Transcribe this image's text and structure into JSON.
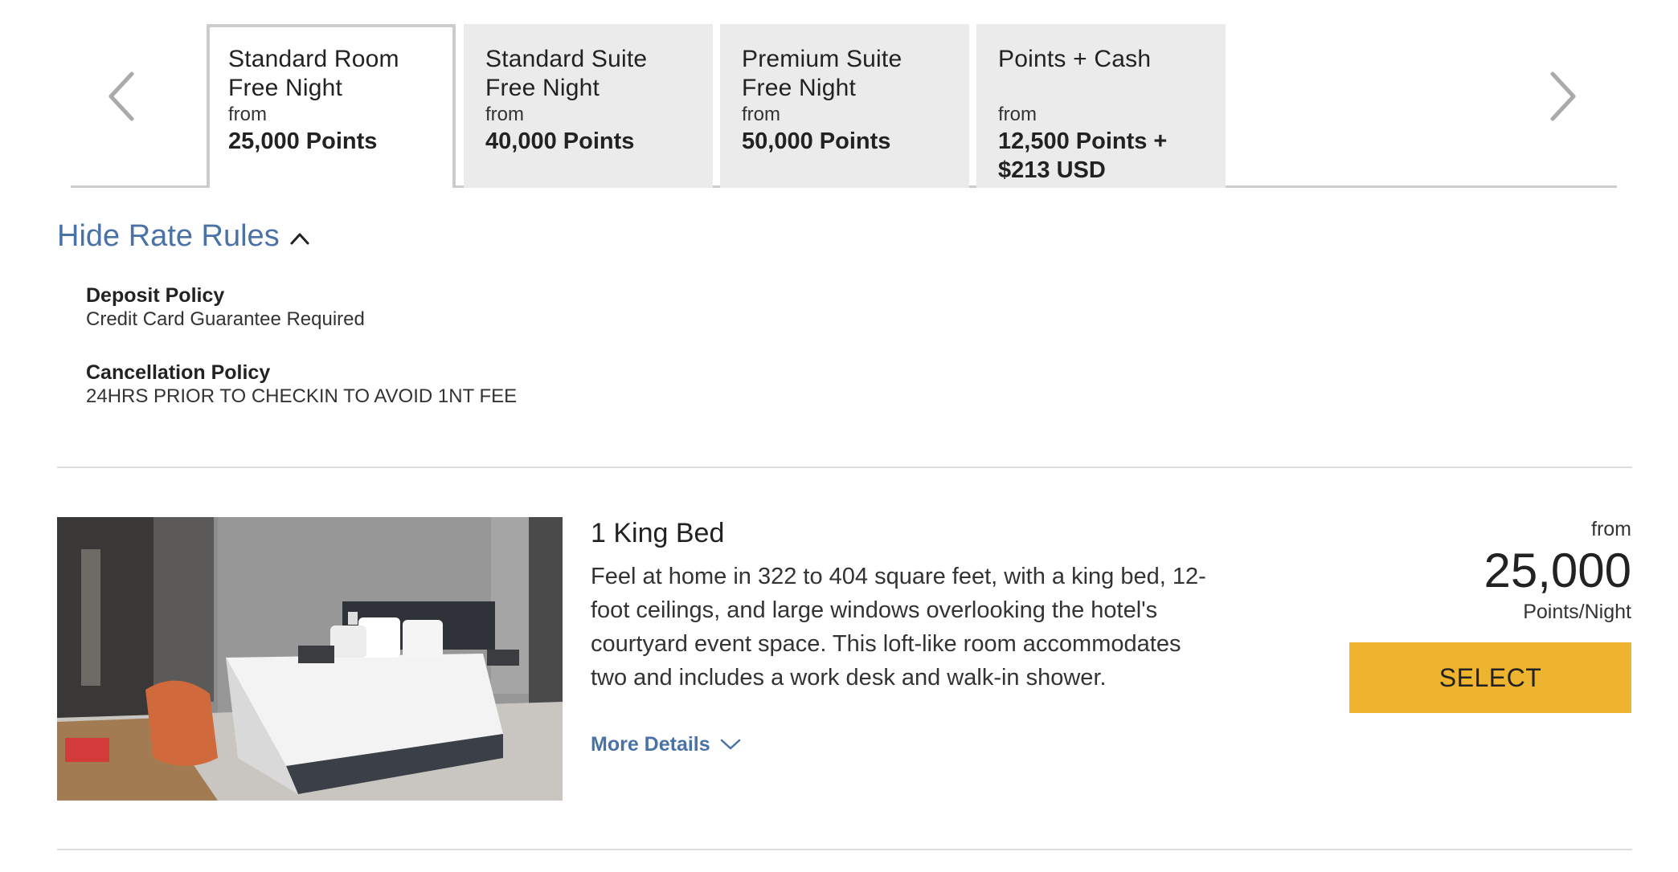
{
  "tabs": [
    {
      "title_line1": "Standard Room",
      "title_line2": "Free Night",
      "from": "from",
      "price_line1": "25,000 Points",
      "price_line2": "",
      "active": true
    },
    {
      "title_line1": "Standard Suite",
      "title_line2": "Free Night",
      "from": "from",
      "price_line1": "40,000 Points",
      "price_line2": "",
      "active": false
    },
    {
      "title_line1": "Premium Suite",
      "title_line2": "Free Night",
      "from": "from",
      "price_line1": "50,000 Points",
      "price_line2": "",
      "active": false
    },
    {
      "title_line1": "Points + Cash",
      "title_line2": "",
      "from": "from",
      "price_line1": "12,500 Points +",
      "price_line2": "$213 USD",
      "active": false
    }
  ],
  "rate_rules": {
    "toggle_label": "Hide Rate Rules",
    "deposit_label": "Deposit Policy",
    "deposit_value": "Credit Card Guarantee Required",
    "cancellation_label": "Cancellation Policy",
    "cancellation_value": "24HRS PRIOR TO CHECKIN TO AVOID 1NT FEE"
  },
  "room": {
    "name": "1 King Bed",
    "description": "Feel at home in 322 to 404 square feet, with a king bed, 12-foot ceilings, and large windows overlooking the hotel's courtyard event space. This loft-like room accommodates two and includes a work desk and walk-in shower.",
    "more_details": "More Details",
    "price_from": "from",
    "price": "25,000",
    "price_unit": "Points/Night",
    "select_label": "SELECT"
  },
  "colors": {
    "link": "#4a72a6",
    "select_button": "#eeb32f",
    "tab_inactive": "#ebebeb",
    "tab_border": "#cccccc"
  },
  "icons": {
    "prev": "chevron-left-icon",
    "next": "chevron-right-icon",
    "collapse": "chevron-up-icon",
    "expand": "chevron-down-icon"
  }
}
